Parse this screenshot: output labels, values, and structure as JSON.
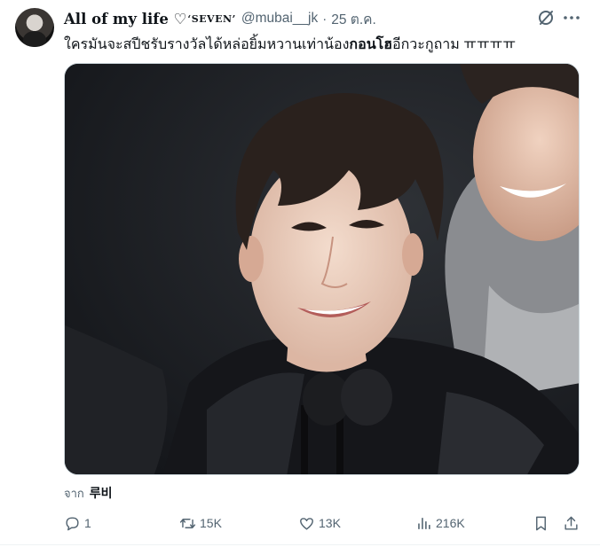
{
  "author": {
    "display_name": "All of my life ♡",
    "display_name_suffix": "‘SEVEN’",
    "handle": "@mubai__jk",
    "separator": "·",
    "date": "25 ต.ค."
  },
  "tweet": {
    "text_before": "ใครมันจะสปีชรับรางวัลได้หล่อยิ้มหวานเท่าน้อง",
    "text_bold": "กอนโฮ",
    "text_after": "อีกวะกูถาม ㅠㅠㅠㅠ"
  },
  "media": {
    "alt": "photo"
  },
  "translation": {
    "prefix": "จาก",
    "source": "루비"
  },
  "actions": {
    "replies": "1",
    "retweets": "15K",
    "likes": "13K",
    "views": "216K"
  },
  "icons": [
    "grok-icon",
    "more-icon",
    "reply-icon",
    "retweet-icon",
    "like-icon",
    "views-icon",
    "bookmark-icon",
    "share-icon"
  ],
  "colors": {
    "text": "#0f1419",
    "secondary": "#536471",
    "border": "#cfd9de"
  }
}
